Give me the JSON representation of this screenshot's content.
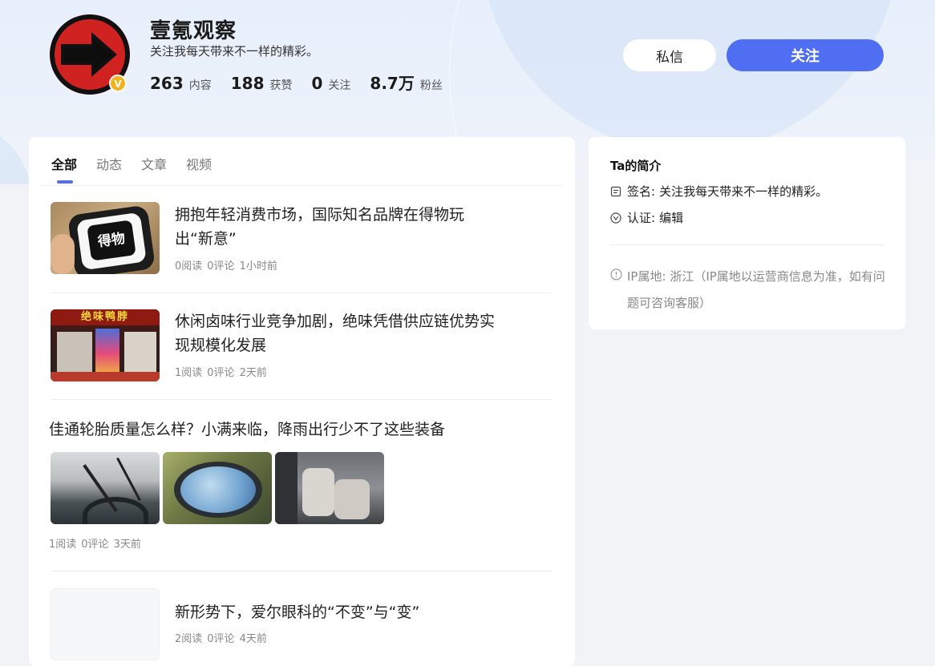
{
  "profile": {
    "name": "壹氪观察",
    "signature": "关注我每天带来不一样的精彩。",
    "badge": "V",
    "stats": [
      {
        "num": "263",
        "label": "内容"
      },
      {
        "num": "188",
        "label": "获赞"
      },
      {
        "num": "0",
        "label": "关注"
      },
      {
        "num": "8.7万",
        "label": "粉丝"
      }
    ],
    "message_label": "私信",
    "follow_label": "关注"
  },
  "tabs": [
    "全部",
    "动态",
    "文章",
    "视频"
  ],
  "active_tab": "全部",
  "feed": [
    {
      "title": "拥抱年轻消费市场，国际知名品牌在得物玩出“新意”",
      "reads": "0阅读",
      "comments": "0评论",
      "time": "1小时前"
    },
    {
      "title": "休闲卤味行业竞争加剧，绝味凭借供应链优势实现规模化发展",
      "reads": "1阅读",
      "comments": "0评论",
      "time": "2天前"
    },
    {
      "title": "佳通轮胎质量怎么样？小满来临，降雨出行少不了这些装备",
      "reads": "1阅读",
      "comments": "0评论",
      "time": "3天前"
    },
    {
      "title": "新形势下，爱尔眼科的“不变”与“变”",
      "reads": "2阅读",
      "comments": "0评论",
      "time": "4天前"
    }
  ],
  "thumb_texts": {
    "app_logo": "得物",
    "shop_sign": "绝味鸭脖"
  },
  "intro": {
    "title": "Ta的简介",
    "signature_label": "签名:",
    "signature": "关注我每天带来不一样的精彩。",
    "cert_label": "认证:",
    "cert": "编辑",
    "ip_label": "IP属地:",
    "ip": "浙江（IP属地以运营商信息为准，如有问题可咨询客服）"
  },
  "colors": {
    "accent": "#4f6ef2",
    "badge": "#f3b21b",
    "avatar_red": "#c41f1f"
  }
}
